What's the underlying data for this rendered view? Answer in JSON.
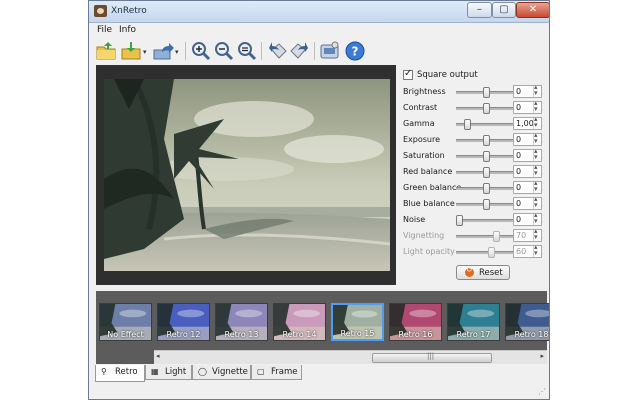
{
  "window": {
    "title": "XnRetro",
    "controls": {
      "minimize": "–",
      "maximize": "▢",
      "close": "✕"
    }
  },
  "menu": [
    {
      "label": "File"
    },
    {
      "label": "Info"
    }
  ],
  "toolbar": {
    "icons": [
      "open-folder-icon",
      "save-icon",
      "share-icon",
      "zoom-in-icon",
      "zoom-out-icon",
      "zoom-fit-icon",
      "rotate-left-icon",
      "rotate-right-icon",
      "settings-icon",
      "help-icon"
    ],
    "dropdown_arrow": "▾"
  },
  "panel": {
    "square_output_label": "Square output",
    "square_output_checked": true,
    "sliders": [
      {
        "label": "Brightness",
        "value": "0",
        "level": 0.5,
        "enabled": true
      },
      {
        "label": "Contrast",
        "value": "0",
        "level": 0.5,
        "enabled": true
      },
      {
        "label": "Gamma",
        "value": "1,00",
        "level": 0.18,
        "enabled": true
      },
      {
        "label": "Exposure",
        "value": "0",
        "level": 0.5,
        "enabled": true
      },
      {
        "label": "Saturation",
        "value": "0",
        "level": 0.5,
        "enabled": true
      },
      {
        "label": "Red balance",
        "value": "0",
        "level": 0.5,
        "enabled": true
      },
      {
        "label": "Green balance",
        "value": "0",
        "level": 0.5,
        "enabled": true
      },
      {
        "label": "Blue balance",
        "value": "0",
        "level": 0.5,
        "enabled": true
      },
      {
        "label": "Noise",
        "value": "0",
        "level": 0.03,
        "enabled": true
      },
      {
        "label": "Vignetting",
        "value": "70",
        "level": 0.68,
        "enabled": false
      },
      {
        "label": "Light opacity",
        "value": "60",
        "level": 0.6,
        "enabled": false
      }
    ],
    "reset_label": "Reset"
  },
  "thumbnails": [
    {
      "label": "No Effect",
      "selected": false,
      "tint": "#6d7fa8"
    },
    {
      "label": "Retro 12",
      "selected": false,
      "tint": "#4a5ec0"
    },
    {
      "label": "Retro 13",
      "selected": false,
      "tint": "#8d86b8"
    },
    {
      "label": "Retro 14",
      "selected": false,
      "tint": "#c99ab9"
    },
    {
      "label": "Retro 15",
      "selected": true,
      "tint": "#9fb0a0"
    },
    {
      "label": "Retro 16",
      "selected": false,
      "tint": "#b04870"
    },
    {
      "label": "Retro 17",
      "selected": false,
      "tint": "#2f7f93"
    },
    {
      "label": "Retro 18",
      "selected": false,
      "tint": "#3f5b8f"
    }
  ],
  "scrollbar": {
    "left": "◂",
    "right": "▸",
    "grip": "|||"
  },
  "tabs": [
    {
      "label": "Retro",
      "icon": "⚲",
      "active": true
    },
    {
      "label": "Light",
      "icon": "▦",
      "active": false
    },
    {
      "label": "Vignette",
      "icon": "◯",
      "active": false
    },
    {
      "label": "Frame",
      "icon": "▢",
      "active": false
    }
  ],
  "colors": {
    "accent": "#4f9df1",
    "reset_icon": "#e36b1c",
    "preview_bg": "#2f2f2f"
  }
}
